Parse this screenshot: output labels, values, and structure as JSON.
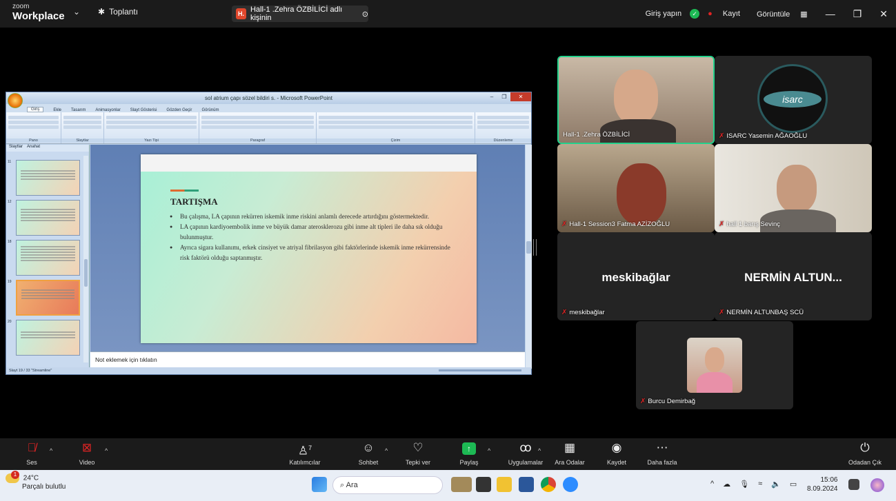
{
  "topbar": {
    "logo_top": "zoom",
    "logo_bottom": "Workplace",
    "meeting_label": "Toplantı",
    "share_badge": "H.",
    "share_text": "Hall-1 .Zehra ÖZBİLİCİ adlı kişinin",
    "signin": "Giriş yapın",
    "record_label": "Kayıt",
    "view_label": "Görüntüle"
  },
  "ppt": {
    "title": "sol atrium çapı sözel bildiri s.  - Microsoft PowerPoint",
    "tabs": [
      "Giriş",
      "Ekle",
      "Tasarım",
      "Animasyonlar",
      "Slayt Gösterisi",
      "Gözden Geçir",
      "Görünüm"
    ],
    "groups": [
      "Pano",
      "Slaytlar",
      "Yazı Tipi",
      "Paragraf",
      "Çizim",
      "Düzenleme"
    ],
    "left_tabs": [
      "Slaytlar",
      "Anahat"
    ],
    "thumb_numbers": [
      "11",
      "12",
      "18",
      "19",
      "20"
    ],
    "slide": {
      "title": "TARTIŞMA",
      "bullets": [
        "Bu çalışma, LA çapının rekürren iskemik inme riskini anlamlı derecede artırdığını göstermektedir.",
        "LA çapının kardiyoembolik inme ve büyük damar aterosklerozu gibi inme alt tipleri ile daha sık olduğu bulunmuştur.",
        "Ayrıca sigara kullanımı, erkek cinsiyet ve atriyal fibrilasyon gibi faktörlerinde iskemik inme rekürrensinde risk faktörü olduğu saptanmıştır."
      ]
    },
    "notes_placeholder": "Not eklemek için tıklatın",
    "status": "Slayt 19 / 33    \"Streamline\""
  },
  "participants": {
    "p1": "Hall-1 .Zehra ÖZBİLİCİ",
    "p2": "ISARC Yasemin AĞAOĞLU",
    "p3": "Hall-1 Session3 Fatma AZİZOĞLU",
    "p4": "hall 1 barış Sevinç",
    "p5_big": "meskibağlar",
    "p5": "meskibağlar",
    "p6_big": "NERMİN ALTUN...",
    "p6": "NERMİN ALTUNBAŞ SCÜ",
    "p7": "Burcu Demirbağ"
  },
  "toolbar": {
    "audio": "Ses",
    "video": "Video",
    "participants": "Katılımcılar",
    "participants_count": "7",
    "chat": "Sohbet",
    "react": "Tepki ver",
    "share": "Paylaş",
    "apps": "Uygulamalar",
    "breakout": "Ara Odalar",
    "record": "Kaydet",
    "more": "Daha fazla",
    "leave": "Odadan Çık"
  },
  "taskbar": {
    "temp": "24°C",
    "weather": "Parçalı bulutlu",
    "weather_badge": "1",
    "search": "Ara",
    "time": "15:06",
    "date": "8.09.2024"
  },
  "colors": {
    "zoom_green": "#1db954",
    "mic_off_red": "#e02424",
    "active_speaker": "#23d18b"
  }
}
